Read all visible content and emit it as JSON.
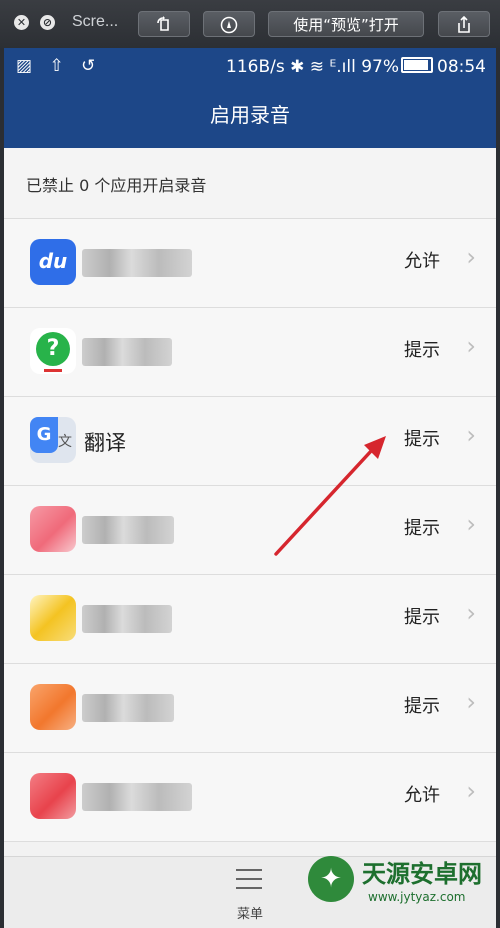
{
  "window": {
    "close_glyph": "✕",
    "stop_glyph": "⊘",
    "title": "Scre...",
    "open_with_preview": "使用“预览”打开"
  },
  "status": {
    "left_icons": "▨ ⇧ ↺",
    "speed": "116B/s",
    "signal": "✱ ≋ ᴱ.ıll",
    "battery": "97%",
    "time": "08:54"
  },
  "header": {
    "title": "启用录音"
  },
  "section": {
    "label": "已禁止 0 个应用开启录音"
  },
  "apps": [
    {
      "icon": "baidu-du-icon",
      "icon_text": "du",
      "name": "",
      "permission": "允许",
      "accent": "#2f6ee8"
    },
    {
      "icon": "question-chat-icon",
      "icon_text": "?",
      "name": "",
      "permission": "提示",
      "accent": "#28b34a"
    },
    {
      "icon": "google-translate-icon",
      "icon_text": "G",
      "name": "翻译",
      "permission": "提示",
      "accent": "#4285f4"
    },
    {
      "icon": "pink-app-icon",
      "icon_text": "",
      "name": "",
      "permission": "提示",
      "accent": "#f06a7a"
    },
    {
      "icon": "yellow-app-icon",
      "icon_text": "",
      "name": "",
      "permission": "提示",
      "accent": "#f4c322"
    },
    {
      "icon": "orange-app-icon",
      "icon_text": "",
      "name": "",
      "permission": "提示",
      "accent": "#f2772d"
    },
    {
      "icon": "red-app-icon",
      "icon_text": "",
      "name": "",
      "permission": "允许",
      "accent": "#e8434c"
    }
  ],
  "chevron": "›",
  "bottom": {
    "menu_label": "菜单"
  },
  "watermark": {
    "logo_glyph": "✦",
    "title": "天源安卓网",
    "url": "www.jytyaz.com"
  },
  "colors": {
    "header": "#1d4788",
    "arrow": "#d6262e"
  }
}
